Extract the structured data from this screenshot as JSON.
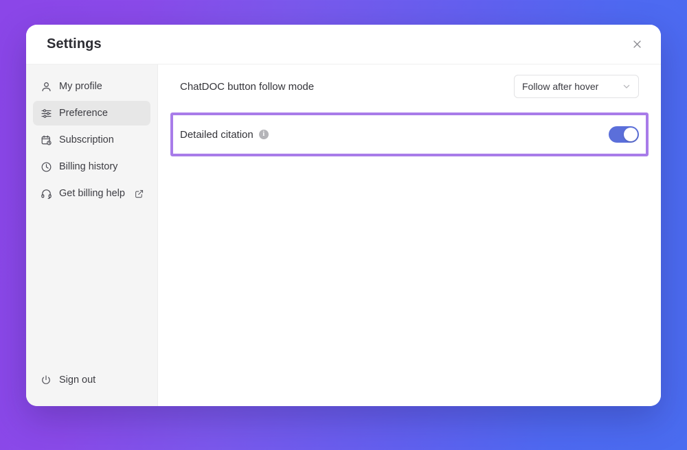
{
  "window": {
    "title": "Settings",
    "close_icon": "close-icon"
  },
  "sidebar": {
    "items": [
      {
        "label": "My profile",
        "icon": "user-icon",
        "active": false,
        "external": false
      },
      {
        "label": "Preference",
        "icon": "sliders-icon",
        "active": true,
        "external": false
      },
      {
        "label": "Subscription",
        "icon": "calendar-clock-icon",
        "active": false,
        "external": false
      },
      {
        "label": "Billing history",
        "icon": "clock-icon",
        "active": false,
        "external": false
      },
      {
        "label": "Get billing help",
        "icon": "headset-icon",
        "active": false,
        "external": true
      }
    ],
    "signout": {
      "label": "Sign out",
      "icon": "power-icon"
    }
  },
  "main": {
    "rows": [
      {
        "label": "ChatDOC button follow mode",
        "control": "select",
        "value": "Follow after hover",
        "chevron_icon": "chevron-down-icon"
      },
      {
        "label": "Detailed citation",
        "control": "toggle",
        "info_icon": "info-icon",
        "toggle_state": "on",
        "highlighted": true
      }
    ]
  },
  "colors": {
    "background_start": "#8b46e8",
    "background_end": "#4a6cf0",
    "toggle_on": "#5b6fda",
    "highlight_border": "#a87ce9",
    "sidebar_bg": "#f5f5f5",
    "active_item_bg": "#e7e7e7"
  }
}
